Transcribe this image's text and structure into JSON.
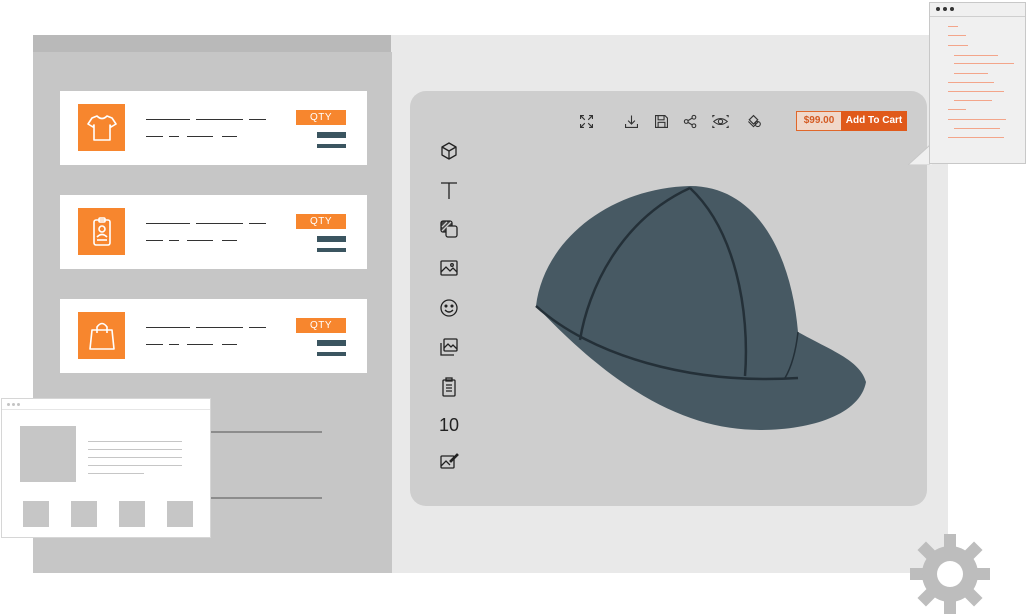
{
  "products": [
    {
      "icon": "tshirt-icon",
      "qty_label": "QTY"
    },
    {
      "icon": "id-badge-icon",
      "qty_label": "QTY"
    },
    {
      "icon": "shopping-bag-icon",
      "qty_label": "QTY"
    }
  ],
  "designer": {
    "top_toolbar": [
      "fullscreen-icon",
      "download-icon",
      "save-icon",
      "share-icon",
      "preview-eye-icon",
      "layers-icon"
    ],
    "side_tools": [
      "3d-box-icon",
      "text-tool-icon",
      "pattern-icon",
      "image-icon",
      "emoji-icon",
      "gallery-icon",
      "clipboard-list-icon",
      "number-tool",
      "edit-image-icon"
    ],
    "number_tool_label": "10",
    "price": "$99.00",
    "add_to_cart_label": "Add To Cart",
    "product_color": "#475963"
  },
  "colors": {
    "accent": "#f7862e",
    "cart_button": "#e05a1b",
    "bar": "#3b5560"
  }
}
